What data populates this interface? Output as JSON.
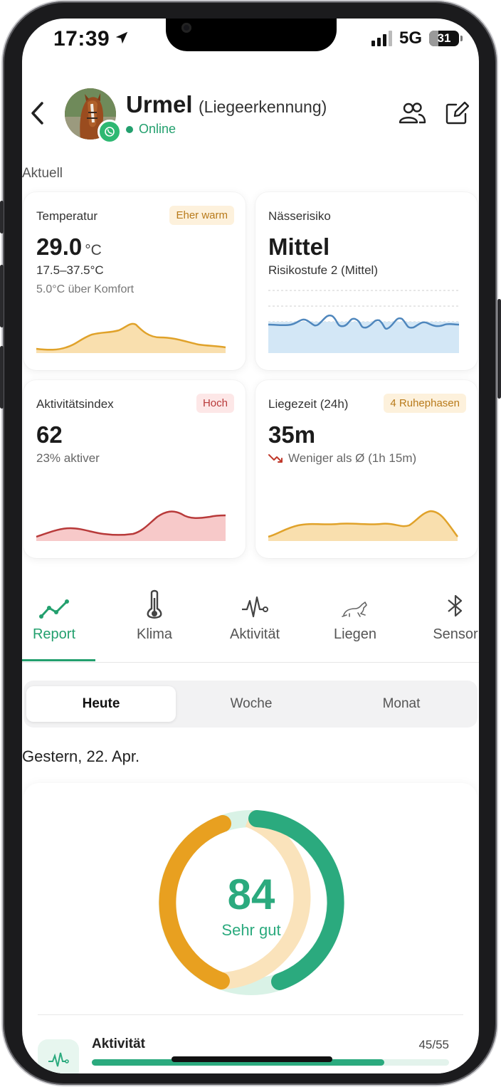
{
  "status_bar": {
    "time": "17:39",
    "network": "5G",
    "battery": "31",
    "battery_level": 0.31
  },
  "header": {
    "name": "Urmel",
    "subtitle": "(Liegeerkennung)",
    "status": "Online"
  },
  "section": {
    "current_label": "Aktuell"
  },
  "cards": {
    "temperature": {
      "label": "Temperatur",
      "tag": "Eher warm",
      "value": "29.0",
      "unit": "°C",
      "range": "17.5–37.5°C",
      "comfort": "5.0°C über Komfort"
    },
    "wetness": {
      "label": "Nässerisiko",
      "value": "Mittel",
      "level": "Risikostufe 2 (Mittel)"
    },
    "activity": {
      "label": "Aktivitätsindex",
      "tag": "Hoch",
      "value": "62",
      "delta": "23% aktiver"
    },
    "lying": {
      "label": "Liegezeit (24h)",
      "tag": "4 Ruhephasen",
      "value": "35m",
      "compare": "Weniger als Ø (1h 15m)"
    }
  },
  "tabs": [
    {
      "label": "Report",
      "icon": "trend-line-icon",
      "active": true
    },
    {
      "label": "Klima",
      "icon": "thermometer-icon",
      "active": false
    },
    {
      "label": "Aktivität",
      "icon": "pulse-icon",
      "active": false
    },
    {
      "label": "Liegen",
      "icon": "horse-icon",
      "active": false
    },
    {
      "label": "Sensor",
      "icon": "bluetooth-icon",
      "active": false
    }
  ],
  "period": {
    "options": [
      "Heute",
      "Woche",
      "Monat"
    ],
    "selected": "Heute"
  },
  "report": {
    "date": "Gestern, 22. Apr.",
    "score": "84",
    "score_label": "Sehr gut",
    "metric": {
      "label": "Aktivität",
      "value": "45/55",
      "fraction": 0.818
    }
  },
  "colors": {
    "accent": "#2baa7e",
    "orange": "#e8a020",
    "red": "#b83a3a",
    "blue": "#4f87bd"
  }
}
